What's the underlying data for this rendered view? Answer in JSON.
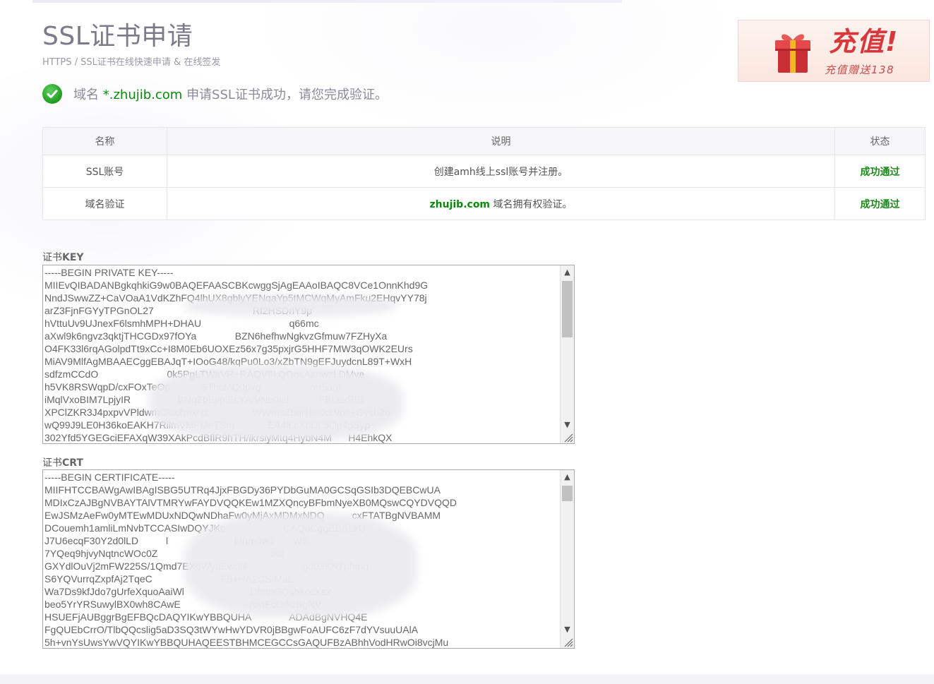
{
  "header": {
    "title": "SSL证书申请",
    "breadcrumb": "HTTPS / SSL证书在线快速申请 & 在线签发"
  },
  "status_message": {
    "prefix": "域名",
    "domain": "*.zhujib.com",
    "suffix": "申请SSL证书成功，请您完成验证。"
  },
  "promo": {
    "title": "充值!",
    "subtitle": "充值赠送138",
    "accent_color": "#d8383c"
  },
  "verification_table": {
    "headers": [
      "名称",
      "说明",
      "状态"
    ],
    "rows": [
      {
        "name": "SSL账号",
        "desc_domain": "",
        "desc": "创建amh线上ssl账号并注册。",
        "status": "成功通过"
      },
      {
        "name": "域名验证",
        "desc_domain": "zhujib.com",
        "desc": " 域名拥有权验证。",
        "status": "成功通过"
      }
    ],
    "status_color": "#1a8a1a"
  },
  "cert_key": {
    "label_prefix": "证书",
    "label_bold": "KEY",
    "lines": [
      "-----BEGIN PRIVATE KEY-----",
      "MIIEvQIBADANBgkqhkiG9w0BAQEFAASCBKcwggSjAgEAAoIBAQC8VCe1OnnKhd9G",
      "NndJSwwZZ+CaVOaA1VdKZhFQ4lhUX8gblyYENqaYp5tMCWqMyAmFku2EHqvYY78j",
      "arZ3FjnFGYyTPGnOL27                                    RI2HSDrlY9p",
      "hVttuUv9UJnexF6lsmhMPH+DHAU                                q66mc",
      "aXwl9k6ngvz3qktjTHCGDx97fOYa              BZN6hefhwNgkvzGfmuw7FZHyXa",
      "O4FK33l6rqAGolpdTt9xCc+I8M0Eb6UOXEz56x7g35pxjrG5HHF7MW3qOWK2EUrs",
      "MiAV9MlfAgMBAAECggEBAJqT+IOoG48/kqPu0Lo3/xZbTN9gEFJuydcnL89T+WxH",
      "sdfzmCCdO                         0k5PgLTWaVR+RAQV8kQOqsAznwzLDMve",
      "h5VK8RSWqpD/cxFOxTeOp           SThcMQ0pvq                  mr5a/p",
      "iMqlVxoBIM7LpjyIR                 BNqZbBj/plEcYA/VNb0lel           FBLexRlB",
      "XPClZKR3J4pxpvVPldwmCkaZmxNz                WWmsZbqrH8KcLvo8+Gysb2o",
      "wQ99J9LE0H36koEAKH7RilmVMFMeTSm            EA4lLcXbDL5Op4pSyp",
      "302Yfd5YGEGciEFAXqW39XAkPcdBflR9hTH/lkrsiyMtq4HybN4M      H4EhkQX"
    ]
  },
  "cert_crt": {
    "label_prefix": "证书",
    "label_bold": "CRT",
    "lines": [
      "-----BEGIN CERTIFICATE-----",
      "MIIFHTCCBAWgAwIBAgISBG5UTRq4JjxFBGDy36PYDbGuMA0GCSqGSIb3DQEBCwUA",
      "MDIxCzAJBgNVBAYTAlVTMRYwFAYDVQQKEw1MZXQncyBFbmNyeXB0MQswCQYDVQQD",
      "EwJSMzAeFw0yMTEwMDUxNDQwNDhaFw0yMjAxMDMxNDQ          cxFTATBgNVBAMM",
      "DCouemh1amliLmNvbTCCASIwDQYJKo                     CAQoCggEBALxU",
      "J7U6ecqF30Y2d0lLD          l                        pInm0wJ       WS",
      "7YQeq9hjvyNqtncWOc0Z                                         oot",
      "GXYdlOuVj2mFW225S/1Qmd7EXqWyaEwol4                    gd03KN7phmo",
      "S6YQVurrqZxpfAj2TqeC                         F5+HA2CS/MaL",
      "Wa7Ds9kfJdo7gUrfeXquoAaiWl                        DfmnGOsbkccXsx",
      "beo5YrYRSuwylBX0wh8CAwE                         AwIFoDAdBgNV",
      "HSUEFjAUBggrBgEFBQcDAQYIKwYBBQUHA              ADAdBgNVHQ4E",
      "FgQUEbCrrO/TlbQQcslig5aD3SQ3tWYwHwYDVR0jBBgwFoAUFC6zF7dYVsuuUAlA",
      "5h+vnYsUwsYwVQYIKwYBBQUHAQEESTBHMCEGCCsGAQUFBzABhhVodHRwOi8vcjMu"
    ]
  }
}
